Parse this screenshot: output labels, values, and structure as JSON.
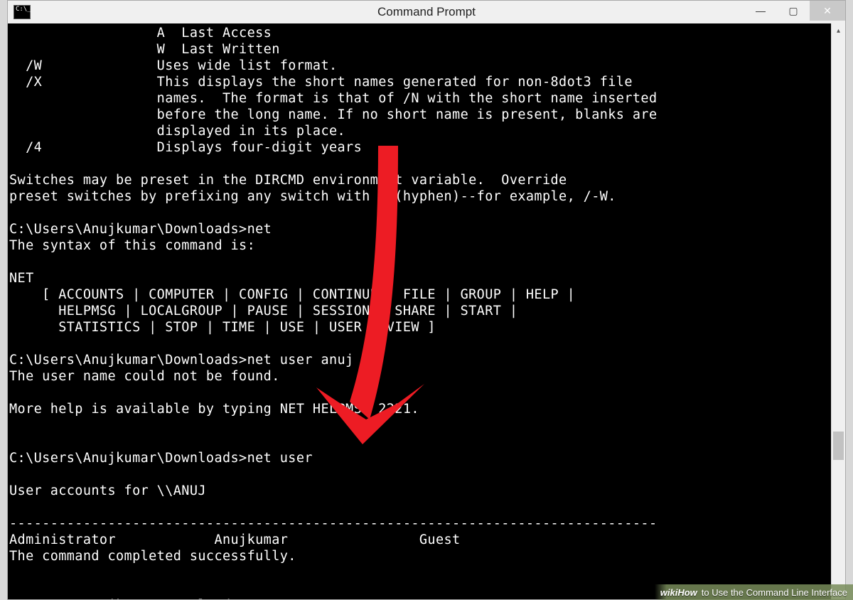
{
  "window": {
    "title": "Command Prompt"
  },
  "controls": {
    "minimize": "—",
    "maximize": "▢",
    "close": "✕"
  },
  "scroll": {
    "up": "▴",
    "down": "▾"
  },
  "terminal_lines": [
    "                  A  Last Access",
    "                  W  Last Written",
    "  /W              Uses wide list format.",
    "  /X              This displays the short names generated for non-8dot3 file",
    "                  names.  The format is that of /N with the short name inserted",
    "                  before the long name. If no short name is present, blanks are",
    "                  displayed in its place.",
    "  /4              Displays four-digit years",
    "",
    "Switches may be preset in the DIRCMD environment variable.  Override",
    "preset switches by prefixing any switch with - (hyphen)--for example, /-W.",
    "",
    "C:\\Users\\Anujkumar\\Downloads>net",
    "The syntax of this command is:",
    "",
    "NET",
    "    [ ACCOUNTS | COMPUTER | CONFIG | CONTINUE | FILE | GROUP | HELP |",
    "      HELPMSG | LOCALGROUP | PAUSE | SESSION | SHARE | START |",
    "      STATISTICS | STOP | TIME | USE | USER | VIEW ]",
    "",
    "C:\\Users\\Anujkumar\\Downloads>net user anuj",
    "The user name could not be found.",
    "",
    "More help is available by typing NET HELPMSG 2221.",
    "",
    "",
    "C:\\Users\\Anujkumar\\Downloads>net user",
    "",
    "User accounts for \\\\ANUJ",
    "",
    "-------------------------------------------------------------------------------",
    "Administrator            Anujkumar                Guest",
    "The command completed successfully.",
    "",
    "",
    "C:\\Users\\Anujkumar\\Downloads>"
  ],
  "caption": {
    "wiki": "wikiHow",
    "text": " to Use the Command Line Interface"
  },
  "arrow_color": "#ed1c24"
}
